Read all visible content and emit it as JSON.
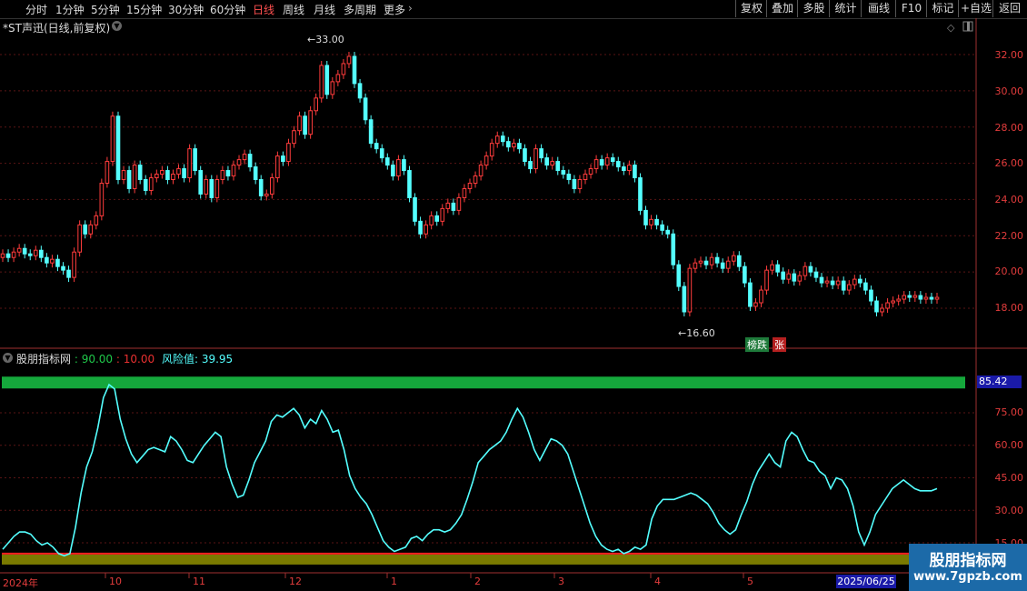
{
  "toolbar": {
    "periods": [
      "分时",
      "1分钟",
      "5分钟",
      "15分钟",
      "30分钟",
      "60分钟",
      "日线",
      "周线",
      "月线",
      "多周期",
      "更多"
    ],
    "buttons": [
      "复权",
      "叠加",
      "多股",
      "统计",
      "画线",
      "F10",
      "标记",
      "+自选",
      "返回"
    ]
  },
  "stock_title": "*ST声迅(日线,前复权)",
  "price_axis": {
    "labels": [
      "32.00",
      "30.00",
      "28.00",
      "26.00",
      "24.00",
      "22.00",
      "20.00",
      "18.00"
    ]
  },
  "annotations": {
    "high": "33.00",
    "low": "16.60"
  },
  "badges": {
    "a": "榜跌",
    "b": "张"
  },
  "indicator": {
    "name": "股朋指标网",
    "upper_label": "90.00",
    "lower_label": "10.00",
    "risk_label": "风险值",
    "risk_value": "39.95",
    "current_value": "85.42",
    "axis_labels": [
      "75.00",
      "60.00",
      "45.00",
      "30.00",
      "15.00"
    ]
  },
  "x_axis": {
    "labels": [
      "2024年",
      "10",
      "11",
      "12",
      "1",
      "2",
      "3",
      "4",
      "5"
    ],
    "selected_date": "2025/06/25"
  },
  "watermark": {
    "title": "股朋指标网",
    "url": "www.7gpzb.com"
  },
  "colors": {
    "up": "#ff3c3c",
    "down": "#54ffff",
    "line": "#54ffff",
    "upper_band": "#15a83c",
    "lower_band": "#7a7a00"
  },
  "chart_data": [
    {
      "type": "candlestick",
      "title": "*ST声迅(日线,前复权)",
      "ylim": [
        16.0,
        33.5
      ],
      "high_mark": 33.0,
      "low_mark": 16.6,
      "closes": [
        21.0,
        20.8,
        21.1,
        21.3,
        21.0,
        20.9,
        21.2,
        20.8,
        20.5,
        20.7,
        20.3,
        20.1,
        19.7,
        21.1,
        22.6,
        22.1,
        22.6,
        23.1,
        24.9,
        26.1,
        28.6,
        25.1,
        25.6,
        24.6,
        25.9,
        25.1,
        24.5,
        25.2,
        25.4,
        25.6,
        25.1,
        25.4,
        25.7,
        25.2,
        26.8,
        25.6,
        24.3,
        25.1,
        24.1,
        25.1,
        25.6,
        25.3,
        25.9,
        26.2,
        26.5,
        25.8,
        25.1,
        24.2,
        24.3,
        25.2,
        26.4,
        26.1,
        27.1,
        27.8,
        28.6,
        27.6,
        28.9,
        29.6,
        31.4,
        29.8,
        30.5,
        30.9,
        31.5,
        31.9,
        30.4,
        29.6,
        28.4,
        27.1,
        26.8,
        26.3,
        25.9,
        25.3,
        26.2,
        25.6,
        24.1,
        22.8,
        22.1,
        22.6,
        23.1,
        22.8,
        23.5,
        23.8,
        23.4,
        24.1,
        24.6,
        24.9,
        25.3,
        25.9,
        26.4,
        27.1,
        27.5,
        27.2,
        26.9,
        27.1,
        26.8,
        26.1,
        25.7,
        26.8,
        26.3,
        25.9,
        26.1,
        25.6,
        25.4,
        25.1,
        24.6,
        25.1,
        25.4,
        25.7,
        26.2,
        25.9,
        26.3,
        26.1,
        25.8,
        25.6,
        25.9,
        25.2,
        23.4,
        22.6,
        22.9,
        22.6,
        22.3,
        22.1,
        20.4,
        19.2,
        17.8,
        20.2,
        20.5,
        20.6,
        20.4,
        20.8,
        20.5,
        20.2,
        20.6,
        20.9,
        20.3,
        19.4,
        18.1,
        18.3,
        19.0,
        20.1,
        20.4,
        20.0,
        19.6,
        19.9,
        19.5,
        19.8,
        20.3,
        20.0,
        19.7,
        19.4,
        19.5,
        19.3,
        19.5,
        19.0,
        19.3,
        19.6,
        19.4,
        19.0,
        18.4,
        17.8,
        18.0,
        18.3,
        18.4,
        18.5,
        18.7,
        18.6,
        18.7,
        18.5,
        18.6,
        18.5,
        18.6
      ]
    },
    {
      "type": "line",
      "name": "风险值",
      "ylim": [
        10,
        90
      ],
      "upper": 90,
      "lower": 10,
      "values": [
        12,
        15,
        18,
        20,
        20,
        19,
        16,
        14,
        15,
        13,
        10,
        9,
        10,
        22,
        38,
        50,
        57,
        68,
        82,
        88,
        86,
        72,
        63,
        56,
        52,
        55,
        58,
        59,
        58,
        57,
        64,
        62,
        58,
        53,
        52,
        56,
        60,
        63,
        66,
        64,
        50,
        42,
        36,
        37,
        44,
        52,
        57,
        62,
        71,
        74,
        73,
        75,
        77,
        74,
        68,
        72,
        70,
        76,
        72,
        66,
        67,
        58,
        46,
        40,
        36,
        33,
        28,
        22,
        16,
        13,
        11,
        12,
        13,
        17,
        18,
        16,
        19,
        21,
        21,
        20,
        21,
        24,
        28,
        35,
        43,
        52,
        55,
        58,
        60,
        62,
        66,
        72,
        77,
        73,
        66,
        58,
        53,
        58,
        63,
        62,
        60,
        56,
        48,
        40,
        32,
        24,
        18,
        14,
        12,
        11,
        12,
        10,
        11,
        13,
        12,
        14,
        26,
        32,
        35,
        35,
        35,
        36,
        37,
        38,
        37,
        35,
        33,
        29,
        24,
        21,
        19,
        21,
        28,
        34,
        42,
        48,
        52,
        56,
        52,
        50,
        62,
        66,
        64,
        58,
        53,
        52,
        48,
        46,
        40,
        45,
        44,
        40,
        32,
        20,
        14,
        20,
        28,
        32,
        36,
        40,
        42,
        44,
        42,
        40,
        39,
        39,
        39,
        40
      ]
    }
  ]
}
